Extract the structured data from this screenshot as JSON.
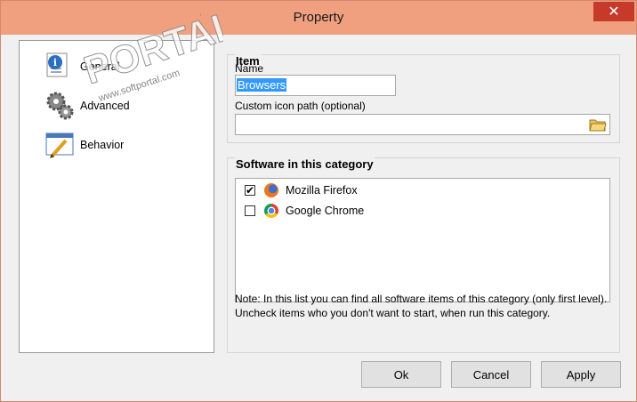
{
  "window": {
    "title": "Property",
    "close_glyph": "✕"
  },
  "sidebar": {
    "items": [
      {
        "label": "General",
        "icon": "general-info-icon"
      },
      {
        "label": "Advanced",
        "icon": "gears-icon"
      },
      {
        "label": "Behavior",
        "icon": "pencil-window-icon"
      }
    ]
  },
  "item_group": {
    "title": "Item",
    "name_label": "Name",
    "name_value": "Browsers",
    "icon_path_label": "Custom icon path (optional)",
    "icon_path_value": "",
    "browse_icon": "folder-open-icon"
  },
  "software_group": {
    "title": "Software in this category",
    "items": [
      {
        "label": "Mozilla Firefox",
        "checked": true,
        "icon": "firefox-icon"
      },
      {
        "label": "Google Chrome",
        "checked": false,
        "icon": "chrome-icon"
      }
    ],
    "note": "Note: In this list you can find all software items of this category (only first level). Uncheck items who you don't want to start, when run this category."
  },
  "buttons": {
    "ok": "Ok",
    "cancel": "Cancel",
    "apply": "Apply"
  },
  "watermark": {
    "text": "PORTAL",
    "url": "www.softportal.com",
    "tm": "TM"
  }
}
